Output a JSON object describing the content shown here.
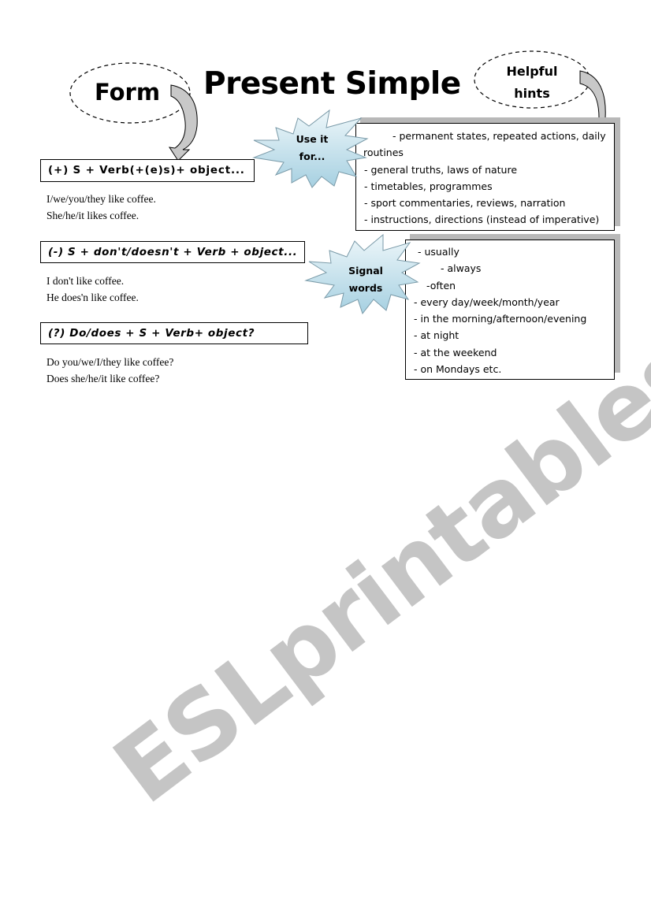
{
  "title": "Present Simple",
  "bubbles": {
    "form": "Form",
    "hints_line1": "Helpful",
    "hints_line2": "hints",
    "use_line1": "Use it",
    "use_line2": "for...",
    "signal_line1": "Signal",
    "signal_line2": "words"
  },
  "forms": [
    {
      "rule": "(+) S + Verb(+(e)s)+ object...",
      "examples": [
        "I/we/you/they like coffee.",
        "She/he/it likes coffee."
      ]
    },
    {
      "rule": "(-) S + don't/doesn't + Verb + object...",
      "examples": [
        "I don't like coffee.",
        "He does'n like coffee."
      ]
    },
    {
      "rule": "(?) Do/does + S + Verb+ object?",
      "examples": [
        "Do you/we/I/they like coffee?",
        "Does she/he/it like coffee?"
      ]
    }
  ],
  "uses": [
    "- permanent states, repeated actions, daily",
    "routines",
    "- general truths, laws of nature",
    "- timetables, programmes",
    "- sport commentaries, reviews, narration",
    "- instructions, directions (instead of imperative)"
  ],
  "signal_words": [
    "- usually",
    "- always",
    "-often",
    "- every day/week/month/year",
    "- in the morning/afternoon/evening",
    "- at night",
    "- at the weekend",
    "- on Mondays etc."
  ],
  "watermark": "ESLprintables.com",
  "colors": {
    "burst_fill_top": "#eaf4f8",
    "burst_fill_bottom": "#a9d3e3",
    "arrow_fill": "#c8c8c8"
  }
}
